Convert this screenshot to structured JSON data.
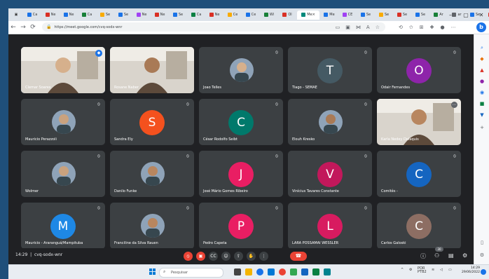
{
  "browser": {
    "url": "https://meet.google.com/cvq-sodx-wnr",
    "active_tab_label": "Me",
    "tabs": [
      "Ca",
      "Ne",
      "Ne",
      "Ca",
      "Se",
      "Se",
      "Ne",
      "Ne",
      "Se",
      "Ca",
      "Ne",
      "Ce",
      "Ce",
      "Wi",
      "Ol",
      "Me",
      "CE",
      "Se",
      "Se",
      "Se",
      "Se",
      "Ar",
      "ar",
      "Se",
      "Ce",
      "Eq"
    ],
    "new_tab": "+",
    "bing_label": "b"
  },
  "meet": {
    "time": "14:29",
    "meeting_code": "cvq-sodx-wnr",
    "participant_count": "30",
    "tiles": [
      {
        "name": "Clemar Soares",
        "type": "video",
        "speaking": true
      },
      {
        "name": "Rosane Naber",
        "type": "video"
      },
      {
        "name": "Joao Telles",
        "type": "photo"
      },
      {
        "name": "Tiago - SEMAE",
        "type": "avatar",
        "initial": "T",
        "color": "#455a64"
      },
      {
        "name": "Odair Fernandes",
        "type": "avatar",
        "initial": "O",
        "color": "#8e24aa"
      },
      {
        "name": "Mauricio Perazzoli",
        "type": "photo"
      },
      {
        "name": "Sandra Ely",
        "type": "avatar",
        "initial": "S",
        "color": "#f4511e"
      },
      {
        "name": "César Rodolfo Seibt",
        "type": "avatar",
        "initial": "C",
        "color": "#00796b"
      },
      {
        "name": "Elouh Kresko",
        "type": "photo"
      },
      {
        "name": "Karla Nedey Delaquis",
        "type": "video"
      },
      {
        "name": "Wolmer",
        "type": "photo"
      },
      {
        "name": "Danilo Funke",
        "type": "photo"
      },
      {
        "name": "José Mário Gomes Ribeiro",
        "type": "avatar",
        "initial": "J",
        "color": "#e91e63"
      },
      {
        "name": "Vinícius Tavares Constante",
        "type": "avatar",
        "initial": "V",
        "color": "#c2185b"
      },
      {
        "name": "Comitês -",
        "type": "avatar",
        "initial": "C",
        "color": "#1565c0"
      },
      {
        "name": "Mauricio - Araranguá/Mampituba",
        "type": "avatar",
        "initial": "M",
        "color": "#1e88e5"
      },
      {
        "name": "Franciline da Silva Rauen",
        "type": "photo"
      },
      {
        "name": "Pedro Capeta",
        "type": "avatar",
        "initial": "P",
        "color": "#e91e63"
      },
      {
        "name": "LARA POSSAMAI WESSLER",
        "type": "avatar",
        "initial": "L",
        "color": "#d81b60"
      },
      {
        "name": "Carlos Galoski",
        "type": "avatar",
        "initial": "C",
        "color": "#8d6e63"
      }
    ]
  },
  "taskbar": {
    "search_placeholder": "Pesquisar",
    "lang": "POR",
    "lang_sub": "PTB2",
    "time": "14:29",
    "date": "29/06/2022"
  }
}
